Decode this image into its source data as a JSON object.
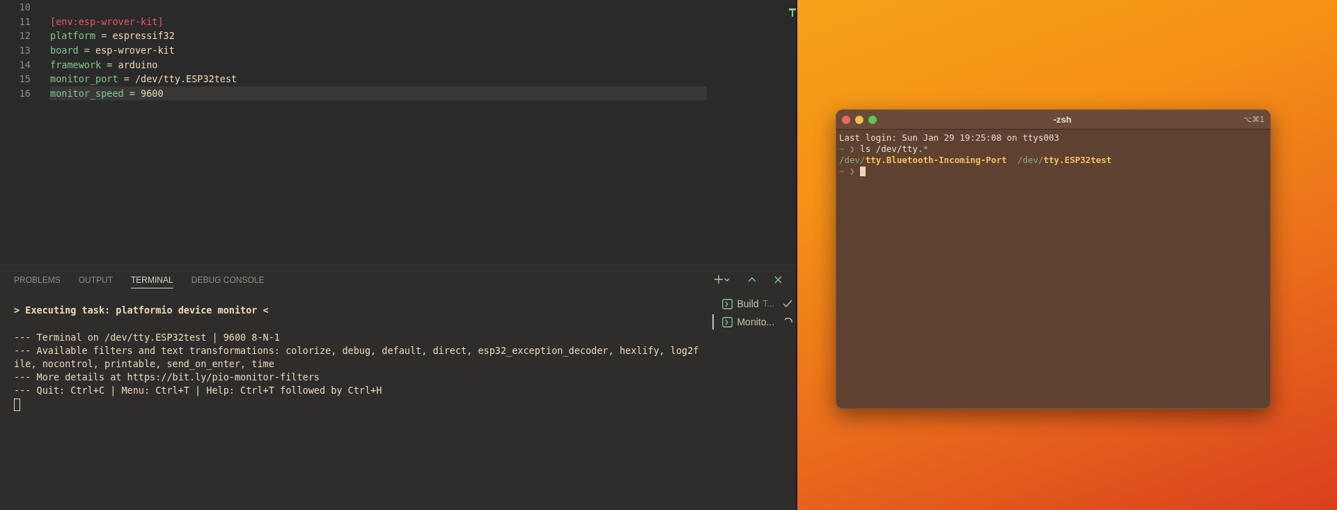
{
  "editor": {
    "lines": [
      {
        "number": "10",
        "current": false
      },
      {
        "number": "11",
        "current": false,
        "tokens": [
          {
            "kind": "section",
            "text": "[env:esp-wrover-kit]"
          }
        ]
      },
      {
        "number": "12",
        "current": false,
        "tokens": [
          {
            "kind": "key",
            "text": "platform"
          },
          {
            "kind": "op",
            "text": " = "
          },
          {
            "kind": "value",
            "text": "espressif32"
          }
        ]
      },
      {
        "number": "13",
        "current": false,
        "tokens": [
          {
            "kind": "key",
            "text": "board"
          },
          {
            "kind": "op",
            "text": " = "
          },
          {
            "kind": "value",
            "text": "esp-wrover-kit"
          }
        ]
      },
      {
        "number": "14",
        "current": false,
        "tokens": [
          {
            "kind": "key",
            "text": "framework"
          },
          {
            "kind": "op",
            "text": " = "
          },
          {
            "kind": "value",
            "text": "arduino"
          }
        ]
      },
      {
        "number": "15",
        "current": false,
        "tokens": [
          {
            "kind": "key",
            "text": "monitor_port"
          },
          {
            "kind": "op",
            "text": " = "
          },
          {
            "kind": "value",
            "text": "/dev/tty.ESP32test"
          }
        ]
      },
      {
        "number": "16",
        "current": true,
        "tokens": [
          {
            "kind": "key",
            "text": "monitor_speed"
          },
          {
            "kind": "op",
            "text": " = "
          },
          {
            "kind": "value",
            "text": "9600"
          }
        ]
      }
    ]
  },
  "panel": {
    "tabs": [
      {
        "label": "PROBLEMS",
        "selected": false
      },
      {
        "label": "OUTPUT",
        "selected": false
      },
      {
        "label": "TERMINAL",
        "selected": true
      },
      {
        "label": "DEBUG CONSOLE",
        "selected": false
      }
    ],
    "task_line": "> Executing task: platformio device monitor <",
    "output": [
      "--- Terminal on /dev/tty.ESP32test | 9600 8-N-1",
      "--- Available filters and text transformations: colorize, debug, default, direct, esp32_exception_decoder, hexlify, log2f",
      "ile, nocontrol, printable, send_on_enter, time",
      "--- More details at https://bit.ly/pio-monitor-filters",
      "--- Quit: Ctrl+C | Menu: Ctrl+T | Help: Ctrl+T followed by Ctrl+H"
    ],
    "tasks": [
      {
        "label": "Build",
        "suffix": "T...",
        "kind": "done",
        "selected": false
      },
      {
        "label": "Monito...",
        "kind": "running",
        "selected": true
      }
    ]
  },
  "mac_terminal": {
    "title": "-zsh",
    "shortcut": "⌥⌘1",
    "lines": [
      [
        {
          "kind": "plain",
          "text": "Last login: Sun Jan 29 19:25:08 on ttys003"
        }
      ],
      [
        {
          "kind": "prompt",
          "text": "~ ❯ "
        },
        {
          "kind": "plain",
          "text": "ls /dev/tty."
        },
        {
          "kind": "glob",
          "text": "*"
        }
      ],
      [
        {
          "kind": "dir",
          "text": "/dev/"
        },
        {
          "kind": "file",
          "text": "tty.Bluetooth-Incoming-Port  "
        },
        {
          "kind": "dir",
          "text": "/dev/"
        },
        {
          "kind": "file",
          "text": "tty.ESP32test"
        }
      ],
      [
        {
          "kind": "prompt",
          "text": "~ ❯ "
        }
      ]
    ]
  }
}
